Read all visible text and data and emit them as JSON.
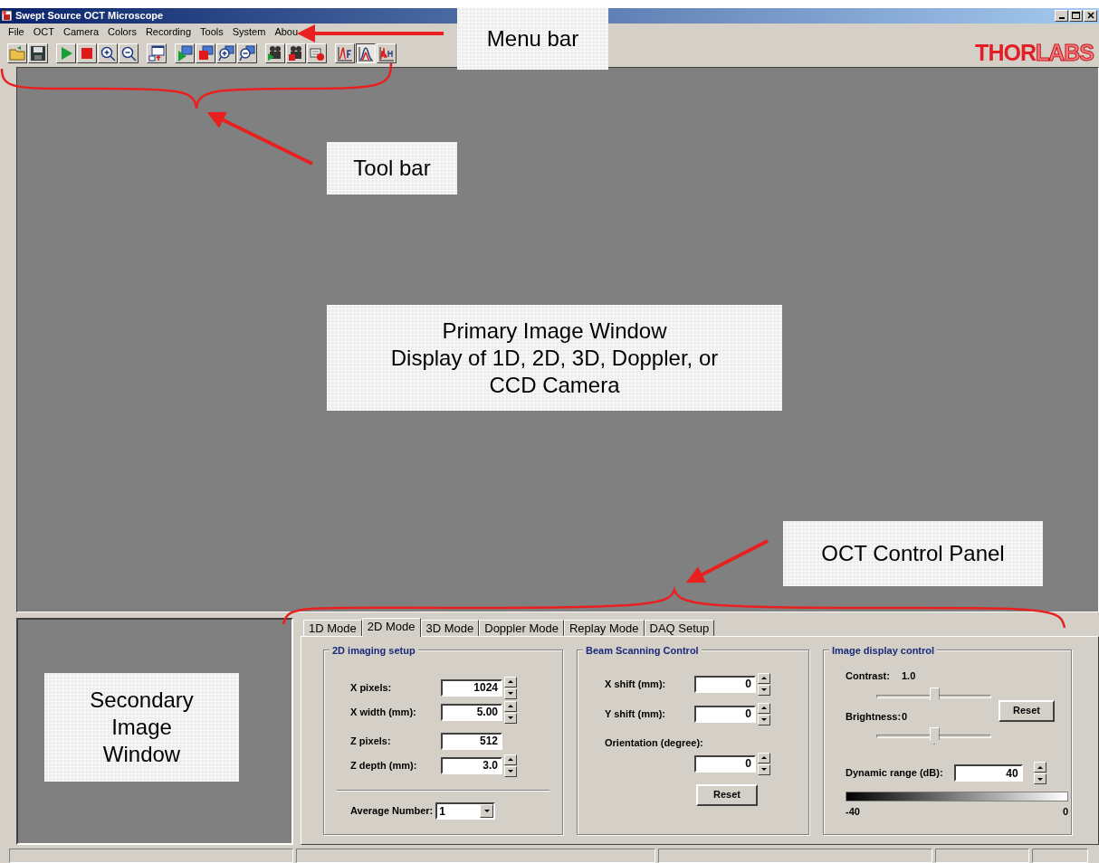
{
  "window": {
    "title": "Swept Source OCT Microscope"
  },
  "menu": [
    "File",
    "OCT",
    "Camera",
    "Colors",
    "Recording",
    "Tools",
    "System",
    "Abou"
  ],
  "toolbar": [
    [
      {
        "kind": "open",
        "pressed": false
      },
      {
        "kind": "save",
        "pressed": false
      }
    ],
    [
      {
        "kind": "play",
        "pressed": false
      },
      {
        "kind": "stop",
        "pressed": false
      },
      {
        "kind": "zoom_in",
        "pressed": false
      },
      {
        "kind": "zoom_out",
        "pressed": false
      }
    ],
    [
      {
        "kind": "export",
        "pressed": false
      }
    ],
    [
      {
        "kind": "screen_play",
        "pressed": false
      },
      {
        "kind": "screen_stop",
        "pressed": false
      },
      {
        "kind": "screen_zoom_in",
        "pressed": false
      },
      {
        "kind": "screen_zoom_out",
        "pressed": false
      }
    ],
    [
      {
        "kind": "camera_play",
        "pressed": false
      },
      {
        "kind": "camera_stop",
        "pressed": false
      },
      {
        "kind": "camera_record",
        "pressed": false
      }
    ],
    [
      {
        "kind": "chart_f",
        "pressed": false
      },
      {
        "kind": "chart_peak",
        "pressed": true
      },
      {
        "kind": "chart_noise",
        "pressed": false
      }
    ]
  ],
  "logo": "**THOR**LABS",
  "tabs": [
    {
      "label": "1D Mode",
      "selected": false
    },
    {
      "label": "2D Mode",
      "selected": true
    },
    {
      "label": "3D Mode",
      "selected": false
    },
    {
      "label": "Doppler Mode",
      "selected": false
    },
    {
      "label": "Replay Mode",
      "selected": false
    },
    {
      "label": "DAQ Setup",
      "selected": false
    }
  ],
  "imaging_setup": {
    "title": "2D imaging setup",
    "fields": [
      {
        "label": "X pixels:",
        "value": "1024",
        "spinner": true
      },
      {
        "label": "X width (mm):",
        "value": "5.00",
        "spinner": true
      },
      {
        "label": "Z pixels:",
        "value": "512",
        "spinner": false
      },
      {
        "label": "Z depth (mm):",
        "value": "3.0",
        "spinner": true
      }
    ],
    "average": {
      "label": "Average Number:",
      "value": "1"
    }
  },
  "beam_scanning": {
    "title": "Beam Scanning Control",
    "fields": [
      {
        "kind": "inline",
        "label": "X shift (mm):",
        "value": "0",
        "spinner": true
      },
      {
        "kind": "inline",
        "label": "Y shift (mm):",
        "value": "0",
        "spinner": true
      },
      {
        "kind": "stacked",
        "label": "Orientation (degree):",
        "value": "0",
        "spinner": true
      }
    ],
    "button": "Reset"
  },
  "display_control": {
    "title": "Image display control",
    "contrast": {
      "label": "Contrast:",
      "reading": "1.0",
      "level": 0.5
    },
    "brightness": {
      "label": "Brightness:",
      "reading": "0",
      "level": 0.5
    },
    "button": "Reset",
    "dynamic_range": {
      "label": "Dynamic range (dB):",
      "value": "40"
    },
    "scale": {
      "min": "-40",
      "max": "0"
    }
  },
  "annotations": [
    {
      "lines": [
        "Menu bar"
      ]
    },
    {
      "lines": [
        "Tool bar"
      ]
    },
    {
      "lines": [
        "Primary Image Window",
        "Display of 1D, 2D, 3D, Doppler, or",
        "CCD Camera"
      ]
    },
    {
      "lines": [
        "OCT Control Panel"
      ]
    },
    {
      "lines": [
        "Secondary",
        "Image",
        "Window"
      ]
    }
  ]
}
